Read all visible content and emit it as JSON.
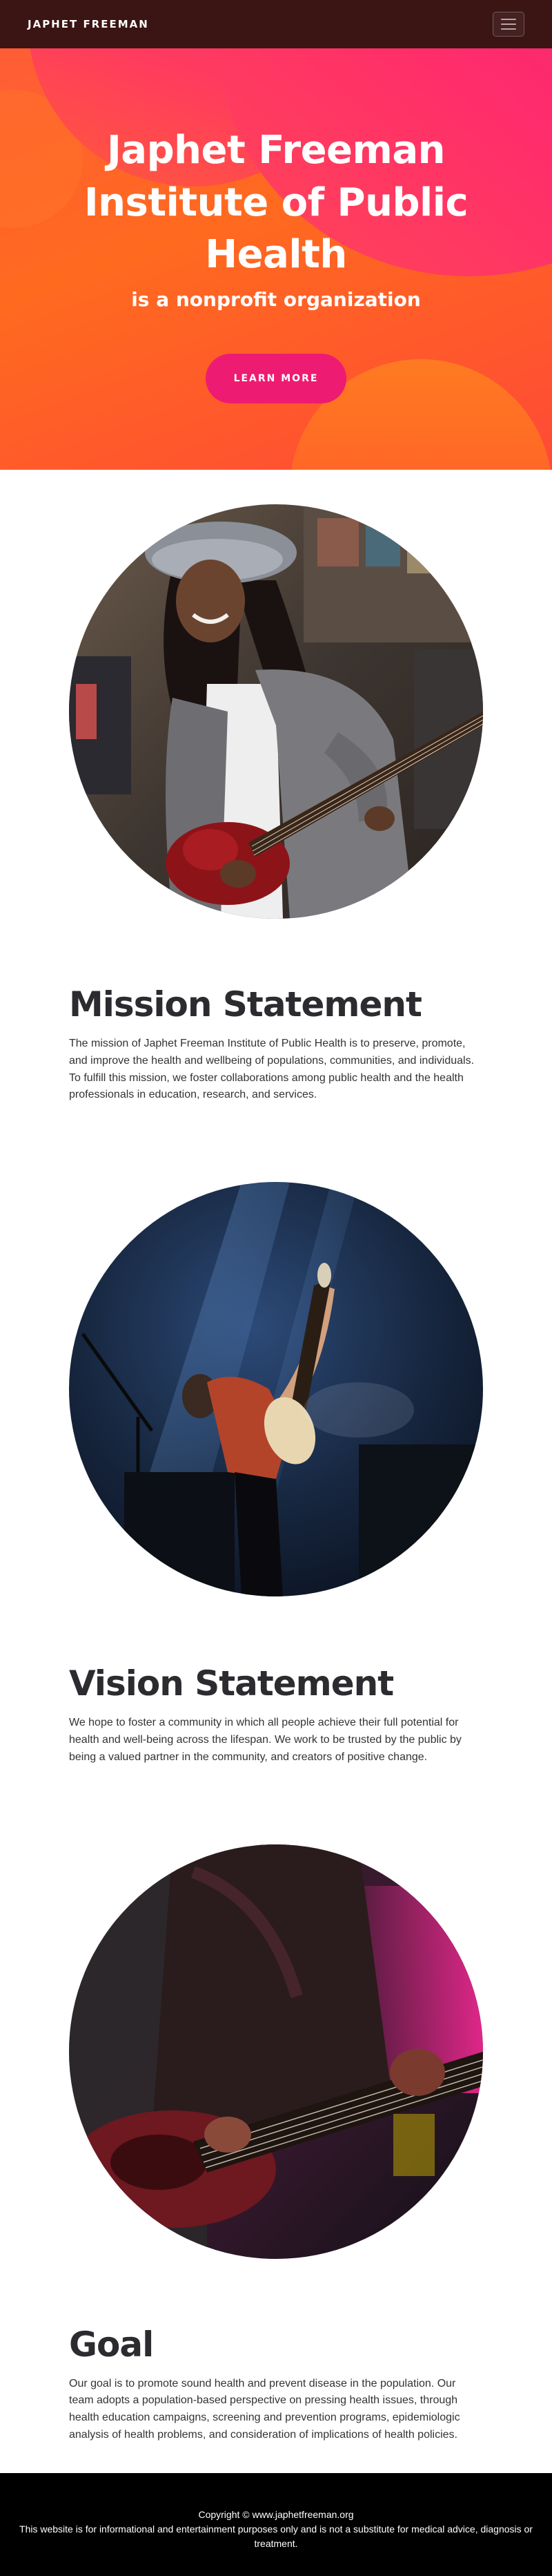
{
  "navbar": {
    "brand": "JAPHET FREEMAN",
    "menu_icon": "hamburger-icon"
  },
  "hero": {
    "title": "Japhet Freeman Institute of Public Health",
    "subtitle": "is a nonprofit organization",
    "button_label": "LEARN MORE"
  },
  "sections": [
    {
      "title": "Mission Statement",
      "text": "The mission of Japhet Freeman Institute of Public Health is to preserve, promote, and improve the health and wellbeing of populations, communities, and individuals. To fulfill this mission, we foster collaborations among public health and the health professionals in education, research, and services."
    },
    {
      "title": "Vision Statement",
      "text": "We hope to foster a community in which all people achieve their full potential for health and well-being across the lifespan. We work to be trusted by the public by being a valued partner in the community, and creators of positive change."
    },
    {
      "title": "Goal",
      "text": "Our goal is to promote sound health and prevent disease in the population. Our team adopts a population-based perspective on pressing health issues, through health education campaigns, screening and prevention programs, epidemiologic analysis of health problems, and consideration of implications of health policies."
    }
  ],
  "footer": {
    "copyright": "Copyright © www.japhetfreeman.org",
    "disclaimer": "This website is for informational and entertainment purposes only and is not a substitute for medical advice, diagnosis or treatment."
  },
  "colors": {
    "navbar_bg": "#3b1414",
    "hero_orange": "#ff6a1f",
    "hero_pink": "#f0197d",
    "button_pink": "#ee1b72",
    "footer_bg": "#000000"
  }
}
